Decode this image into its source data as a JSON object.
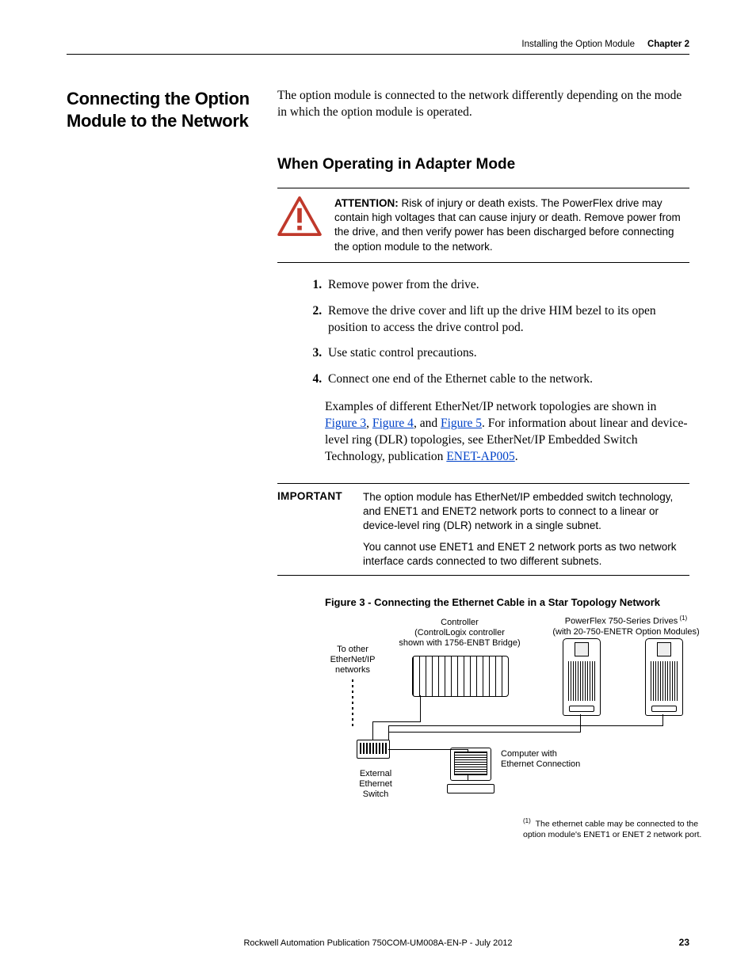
{
  "header": {
    "section": "Installing the Option Module",
    "chapter": "Chapter 2"
  },
  "sidehead": "Connecting the Option Module to the Network",
  "intro": "The option module is connected to the network differently depending on the mode in which the option module is operated.",
  "subhead": "When Operating in Adapter Mode",
  "attention": {
    "lead": "ATTENTION:",
    "text": " Risk of injury or death exists. The PowerFlex drive may contain high voltages that can cause injury or death. Remove power from the drive, and then verify power has been discharged before connecting the option module to the network."
  },
  "steps": [
    "Remove power from the drive.",
    "Remove the drive cover and lift up the drive HIM bezel to its open position to access the drive control pod.",
    "Use static control precautions.",
    "Connect one end of the Ethernet cable to the network."
  ],
  "examples": {
    "pre": "Examples of different EtherNet/IP network topologies are shown in ",
    "link1": "Figure 3",
    "sep1": ", ",
    "link2": "Figure 4",
    "sep2": ", and ",
    "link3": "Figure 5",
    "mid": ". For information about linear and device-level ring (DLR) topologies, see EtherNet/IP Embedded Switch Technology, publication ",
    "link4": "ENET-AP005",
    "end": "."
  },
  "important": {
    "label": "IMPORTANT",
    "p1": "The option module has EtherNet/IP embedded switch technology, and ENET1 and ENET2 network ports to connect to a linear or device-level ring (DLR) network in a single subnet.",
    "p2": "You cannot use ENET1 and ENET 2 network ports as two network interface cards connected to two different subnets."
  },
  "figcaption": "Figure 3 - Connecting the Ethernet Cable in a Star Topology Network",
  "figlabels": {
    "drives_top": "PowerFlex 750-Series Drives",
    "drives_sub": "(with 20-750-ENETR Option Modules)",
    "controller_top": "Controller",
    "controller_sub1": "(ControlLogix controller",
    "controller_sub2": "shown with 1756-ENBT Bridge)",
    "toother1": "To other",
    "toother2": "EtherNet/IP",
    "toother3": "networks",
    "switch1": "External",
    "switch2": "Ethernet",
    "switch3": "Switch",
    "computer1": "Computer with",
    "computer2": "Ethernet Connection"
  },
  "footnote": {
    "mark": "(1)",
    "text": "The ethernet cable may be connected to the option module's ENET1 or ENET 2 network port."
  },
  "footer": {
    "pub": "Rockwell Automation Publication 750COM-UM008A-EN-P - July 2012",
    "page": "23"
  }
}
